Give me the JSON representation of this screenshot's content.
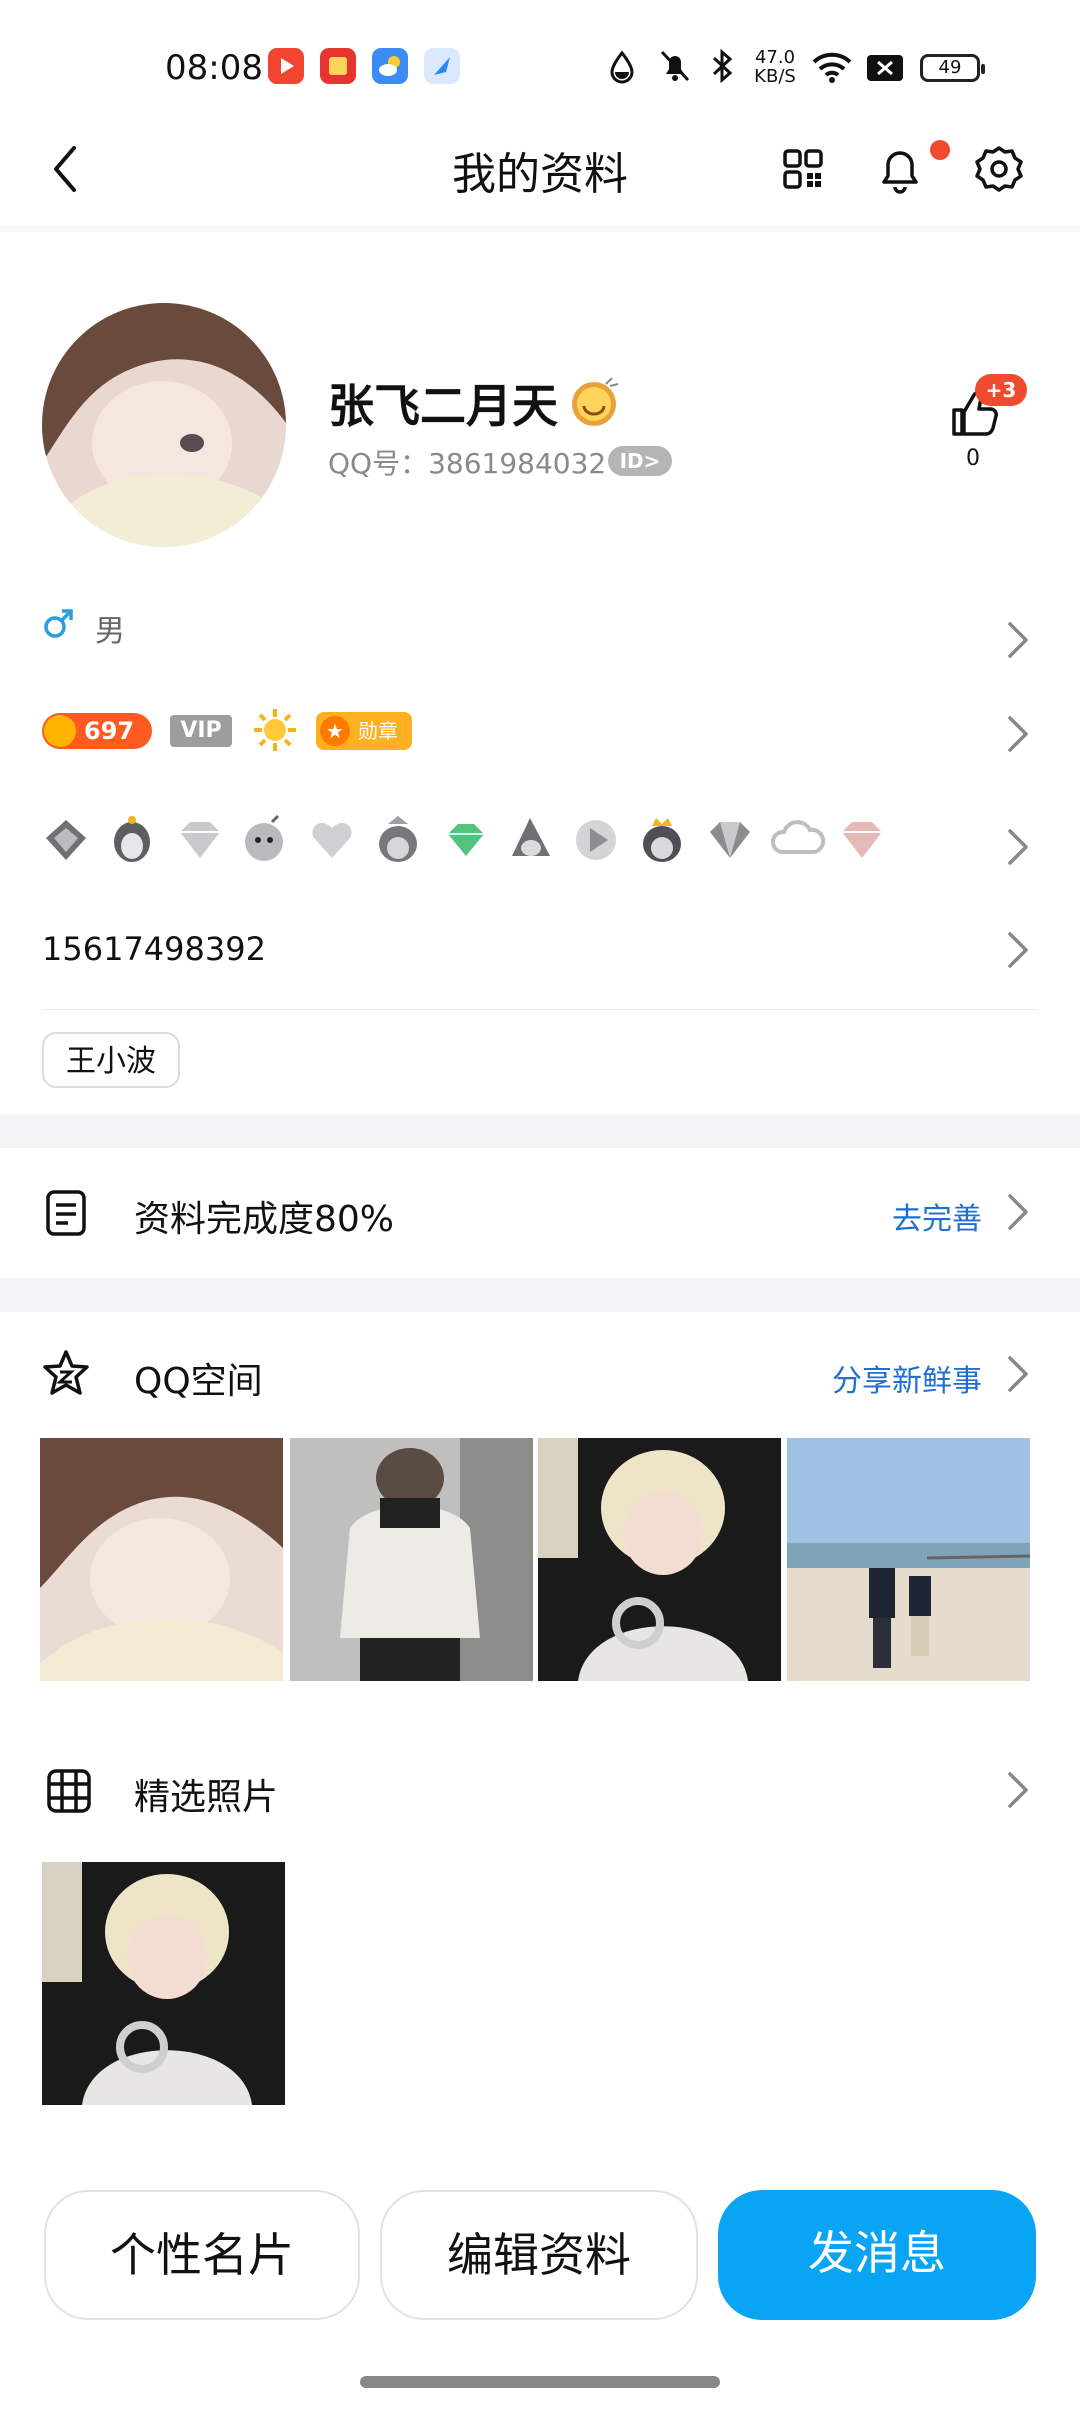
{
  "status_bar": {
    "time": "08:08",
    "net_speed_value": "47.0",
    "net_speed_unit": "KB/S",
    "battery": "49"
  },
  "header": {
    "title": "我的资料",
    "has_notification_dot": true
  },
  "profile": {
    "nickname": "张飞二月天",
    "qq_number_label": "QQ号：3861984032",
    "id_badge": "ID>",
    "like_plus": "+3",
    "like_count": "0",
    "gender": "男",
    "level": "697",
    "vip_badge": "VIP",
    "medal_badge": "勋章",
    "phone": "15617498392",
    "tag": "王小波"
  },
  "completion": {
    "label": "资料完成度80%",
    "action": "去完善"
  },
  "qzone": {
    "label": "QQ空间",
    "action": "分享新鲜事"
  },
  "featured": {
    "label": "精选照片"
  },
  "buttons": {
    "card": "个性名片",
    "edit": "编辑资料",
    "message": "发消息"
  },
  "colors": {
    "accent_blue": "#0aa4f4",
    "link_blue": "#1f6fd1",
    "notification_red": "#f04a2f"
  }
}
